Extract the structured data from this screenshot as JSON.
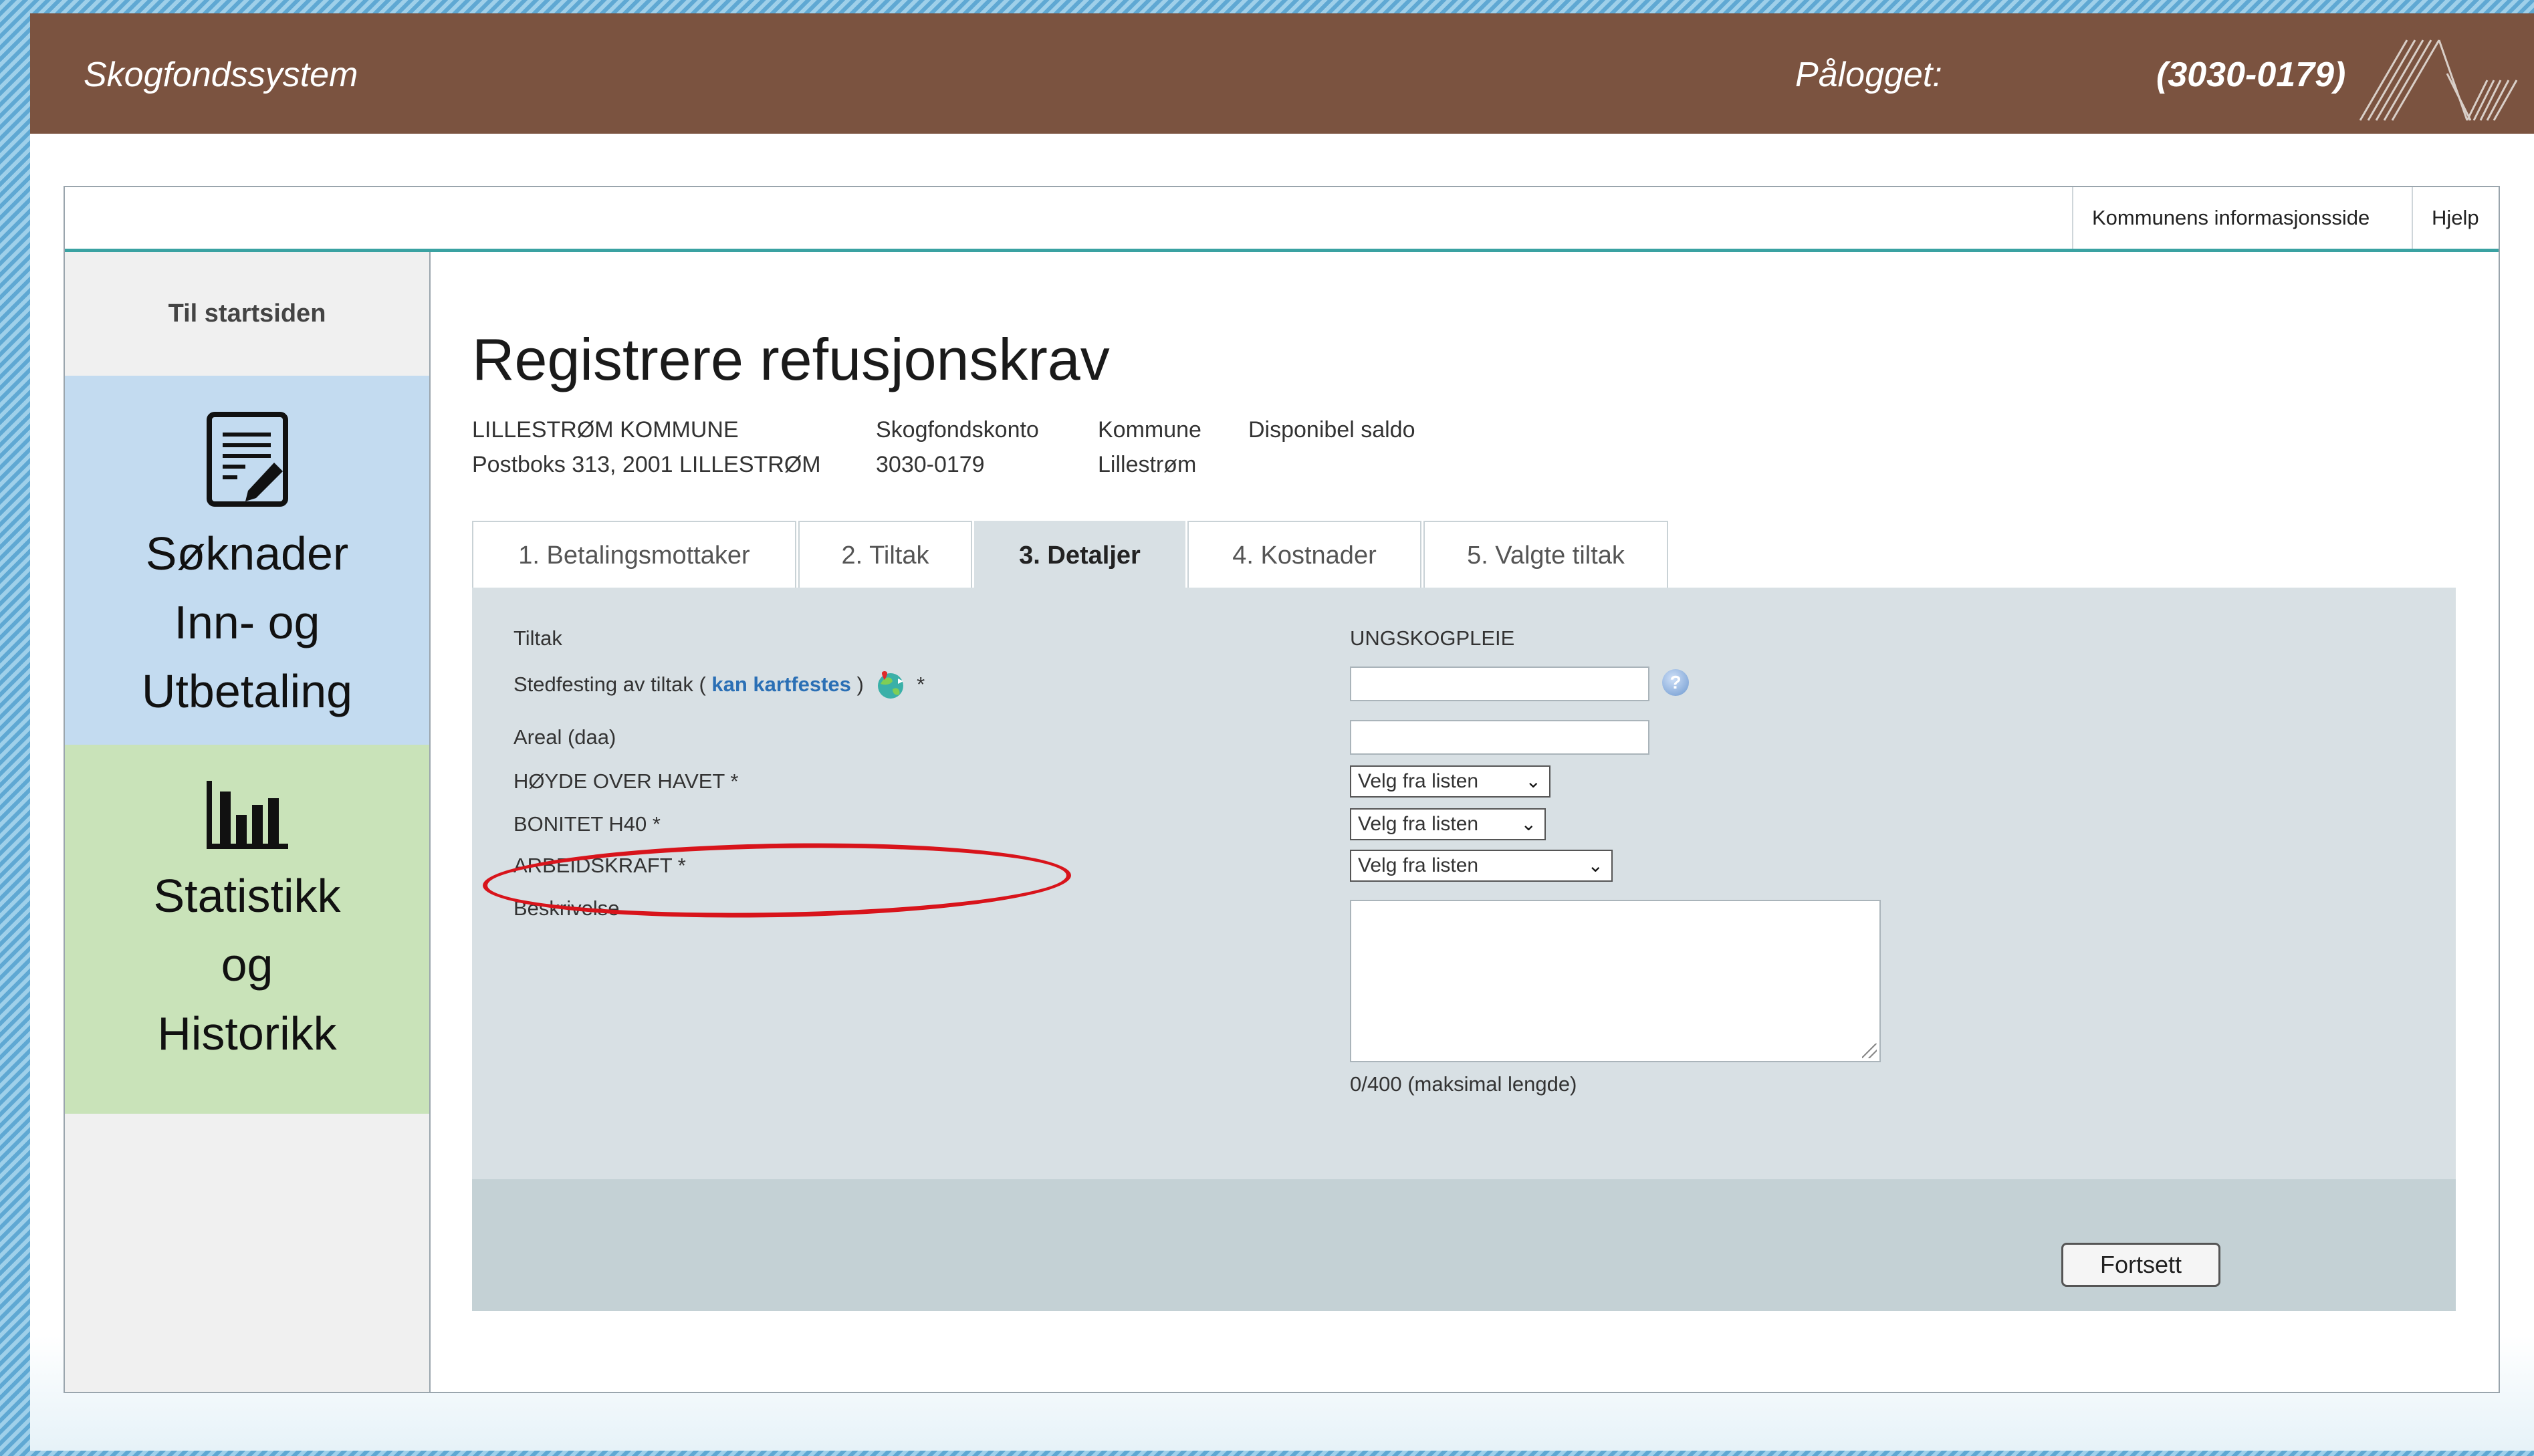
{
  "header": {
    "app_title": "Skogfondssystem",
    "login_label": "Pålogget:",
    "login_value": "(3030-0179)"
  },
  "topnav": {
    "links": [
      "Kommunens informasjonsside",
      "Hjelp"
    ]
  },
  "sidebar": {
    "home_label": "Til startsiden",
    "tiles": [
      {
        "lines": [
          "Søknader",
          "Inn- og",
          "Utbetaling"
        ],
        "icon": "document-edit-icon",
        "color": "#c3dbf0"
      },
      {
        "lines": [
          "Statistikk",
          "og",
          "Historikk"
        ],
        "icon": "bar-chart-icon",
        "color": "#c9e3b9"
      }
    ]
  },
  "page": {
    "title": "Registrere refusjonskrav",
    "payee": {
      "name": "LILLESTRØM KOMMUNE",
      "address": "Postboks 313, 2001 LILLESTRØM"
    },
    "account": {
      "label": "Skogfondskonto",
      "value": "3030-0179"
    },
    "municipality": {
      "label": "Kommune",
      "value": "Lillestrøm"
    },
    "balance": {
      "label": "Disponibel saldo",
      "value": ""
    }
  },
  "tabs": [
    "1. Betalingsmottaker",
    "2. Tiltak",
    "3. Detaljer",
    "4. Kostnader",
    "5. Valgte tiltak"
  ],
  "active_tab": "3. Detaljer",
  "form": {
    "tiltak_label": "Tiltak",
    "tiltak_value": "UNGSKOGPLEIE",
    "stedfesting_label": "Stedfesting av tiltak",
    "open_paren": "(",
    "map_link": "kan kartfestes",
    "close_paren": ")",
    "required_mark": "*",
    "stedfesting_value": "",
    "areal_label": "Areal (daa)",
    "areal_value": "",
    "hoyde_label": "HØYDE OVER HAVET *",
    "hoyde_value": "Velg fra listen",
    "bonitet_label": "BONITET H40 *",
    "bonitet_value": "Velg fra listen",
    "arbeidskraft_label": "ARBEIDSKRAFT *",
    "arbeidskraft_value": "Velg fra listen",
    "beskrivelse_label": "Beskrivelse",
    "beskrivelse_value": "",
    "counter_text": "0/400 (maksimal lengde)",
    "help_glyph": "?"
  },
  "buttons": {
    "continue": "Fortsett"
  },
  "colors": {
    "topbar": "#7b5340",
    "accent_line": "#3aa2a2",
    "link": "#2a6fb5",
    "highlight": "#d8141b",
    "panel": "#d8e0e4",
    "footer_panel": "#c4d1d5"
  }
}
